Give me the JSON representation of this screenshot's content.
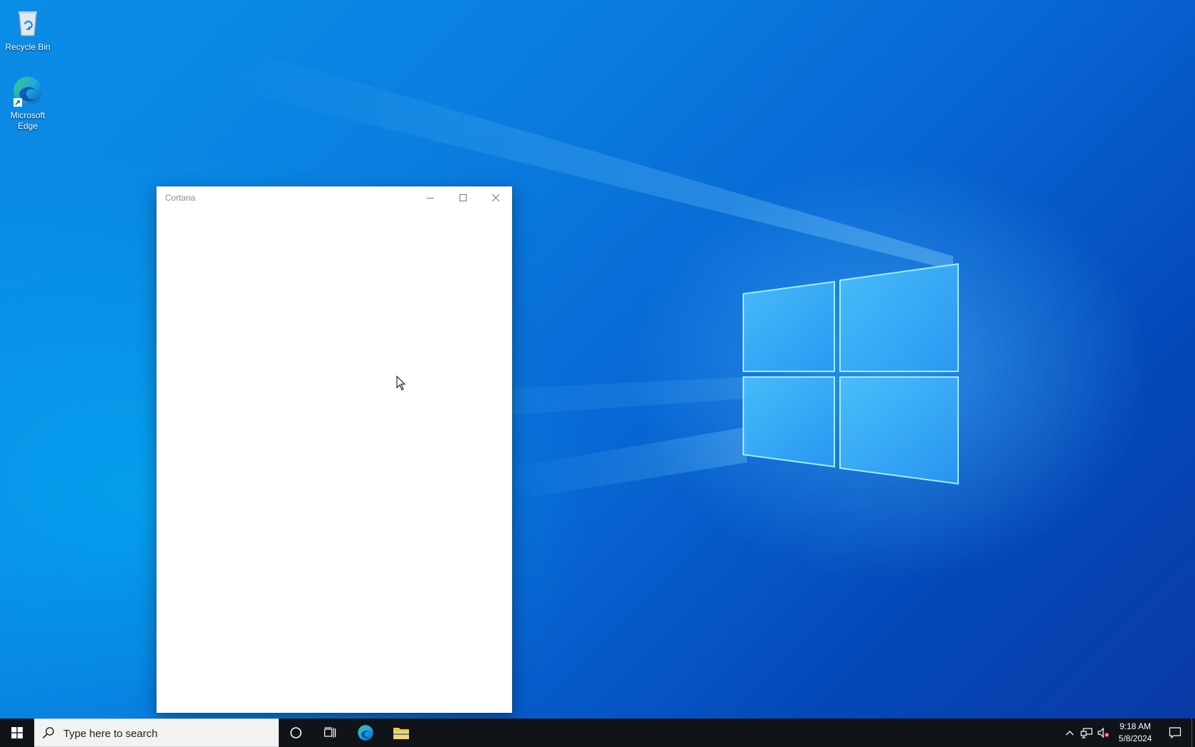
{
  "desktop": {
    "icons": [
      {
        "label": "Recycle Bin",
        "icon": "recycle-bin-icon"
      },
      {
        "label": "Microsoft Edge",
        "icon": "edge-icon"
      }
    ]
  },
  "window": {
    "title": "Cortana",
    "buttons": {
      "minimize": "minimize-icon",
      "maximize": "maximize-icon",
      "close": "close-icon"
    }
  },
  "taskbar": {
    "search_placeholder": "Type here to search",
    "pinned": [
      "cortana-icon",
      "task-view-icon",
      "edge-icon",
      "file-explorer-icon"
    ],
    "tray": [
      "chevron-up-icon",
      "network-icon",
      "volume-muted-icon"
    ],
    "clock": {
      "time": "9:18 AM",
      "date": "5/8/2024"
    }
  },
  "colors": {
    "taskbar_bg": "#101318",
    "desktop_accent": "#0a7fe0",
    "window_bg": "#ffffff"
  }
}
